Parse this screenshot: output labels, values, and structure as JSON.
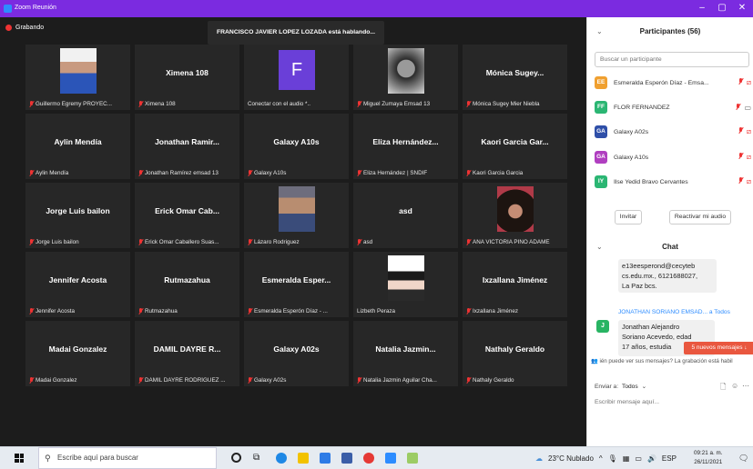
{
  "window": {
    "title": "Zoom Reunión"
  },
  "video": {
    "recording_label": "Grabando",
    "speaking_banner": "FRANCISCO JAVIER LOPEZ LOZADA está hablando...",
    "tiles": [
      {
        "name": "",
        "label": "Guillermo Egremy PROYEC...",
        "muted": true,
        "kind": "photo-man"
      },
      {
        "name": "Ximena 108",
        "label": "Ximena 108",
        "muted": true,
        "kind": "name"
      },
      {
        "name": "",
        "label": "Conectar con el audio *..",
        "muted": false,
        "kind": "avatar-f",
        "avatar_letter": "F"
      },
      {
        "name": "",
        "label": "Miguel Zumaya Emsad 13",
        "muted": true,
        "kind": "photo-bw"
      },
      {
        "name": "Mónica Sugey...",
        "label": "Mónica Sugey Mier Niebla",
        "muted": true,
        "kind": "name"
      },
      {
        "name": "Aylin Mendía",
        "label": "Aylin Mendía",
        "muted": true,
        "kind": "name"
      },
      {
        "name": "Jonathan Ramir...",
        "label": "Jonathan Ramírez emsad 13",
        "muted": true,
        "kind": "name"
      },
      {
        "name": "Galaxy A10s",
        "label": "Galaxy A10s",
        "muted": true,
        "kind": "name"
      },
      {
        "name": "Eliza Hernández...",
        "label": "Eliza Hernández | SNDIF",
        "muted": true,
        "kind": "name"
      },
      {
        "name": "Kaori Garcia Gar...",
        "label": "Kaori Garcia Garcia",
        "muted": true,
        "kind": "name"
      },
      {
        "name": "Jorge Luis bailon",
        "label": "Jorge Luis bailon",
        "muted": true,
        "kind": "name"
      },
      {
        "name": "Erick Omar Cab...",
        "label": "Erick Omar Caballero Suas...",
        "muted": true,
        "kind": "name"
      },
      {
        "name": "",
        "label": "Lázaro Rodriguez",
        "muted": true,
        "kind": "photo-boy"
      },
      {
        "name": "asd",
        "label": "asd",
        "muted": true,
        "kind": "name"
      },
      {
        "name": "",
        "label": "ANA VICTORIA PINO ADAME",
        "muted": true,
        "kind": "photo-girl"
      },
      {
        "name": "Jennifer Acosta",
        "label": "Jennifer Acosta",
        "muted": true,
        "kind": "name"
      },
      {
        "name": "Rutmazahua",
        "label": "Rutmazahua",
        "muted": true,
        "kind": "name"
      },
      {
        "name": "Esmeralda Esper...",
        "label": "Esmeralda Esperón Díaz - ...",
        "muted": true,
        "kind": "name"
      },
      {
        "name": "",
        "label": "Lizbeth Peraza",
        "muted": false,
        "kind": "photo-bunny"
      },
      {
        "name": "Ixzallana Jiménez",
        "label": "Ixzallana Jiménez",
        "muted": true,
        "kind": "name"
      },
      {
        "name": "Madai Gonzalez",
        "label": "Madai Gonzalez",
        "muted": true,
        "kind": "name"
      },
      {
        "name": "DAMIL DAYRE R...",
        "label": "DAMIL DAYRE RODRÍGUEZ ...",
        "muted": true,
        "kind": "name"
      },
      {
        "name": "Galaxy A02s",
        "label": "Galaxy A02s",
        "muted": true,
        "kind": "name"
      },
      {
        "name": "Natalia Jazmin...",
        "label": "Natalia Jazmin Aguilar Cha...",
        "muted": true,
        "kind": "name"
      },
      {
        "name": "Nathaly Geraldo",
        "label": "Nathaly Geraldo",
        "muted": true,
        "kind": "name"
      }
    ]
  },
  "participants": {
    "title": "Participantes (56)",
    "search_placeholder": "Buscar un participante",
    "list": [
      {
        "initials": "EE",
        "name": "Esmeralda Esperón Díaz - Emsa...",
        "color": "#f0a030",
        "icons": "mic-muted,video-off"
      },
      {
        "initials": "FF",
        "name": "FLOR FERNANDEZ",
        "color": "#2bb673",
        "icons": "mic-muted,video"
      },
      {
        "initials": "GA",
        "name": "Galaxy A02s",
        "color": "#2f4fa8",
        "icons": "mic-muted,video-off"
      },
      {
        "initials": "GA",
        "name": "Galaxy A10s",
        "color": "#b03fc0",
        "icons": "mic-muted,video-off"
      },
      {
        "initials": "IY",
        "name": "Ilse Yedid Bravo Cervantes",
        "color": "#2bb673",
        "icons": "mic-muted,video-off"
      }
    ],
    "invite_label": "Invitar",
    "reactivate_label": "Reactivar mi audio"
  },
  "chat": {
    "title": "Chat",
    "prev_message_lines": [
      "e13eesperond@cecyteb",
      "cs.edu.mx., 6121688027,",
      "La Paz bcs."
    ],
    "message_header": "JONATHAN SORIANO EMSAD... a Todos",
    "message_avatar": "J",
    "message_lines": [
      "Jonathan Alejandro",
      "Soriano Acevedo, edad",
      "17 años, estudia"
    ],
    "new_messages": "5 nuevos mensajes ↓",
    "notice": "ién puede ver sus mensajes? La grabación está habil",
    "send_to_label": "Enviar a:",
    "send_to_value": "Todos",
    "compose_placeholder": "Escribir mensaje aquí..."
  },
  "taskbar": {
    "search_placeholder": "Escribe aquí para buscar",
    "weather": "23°C Nublado",
    "language": "ESP",
    "time": "09:21 a. m.",
    "date": "26/11/2021"
  }
}
